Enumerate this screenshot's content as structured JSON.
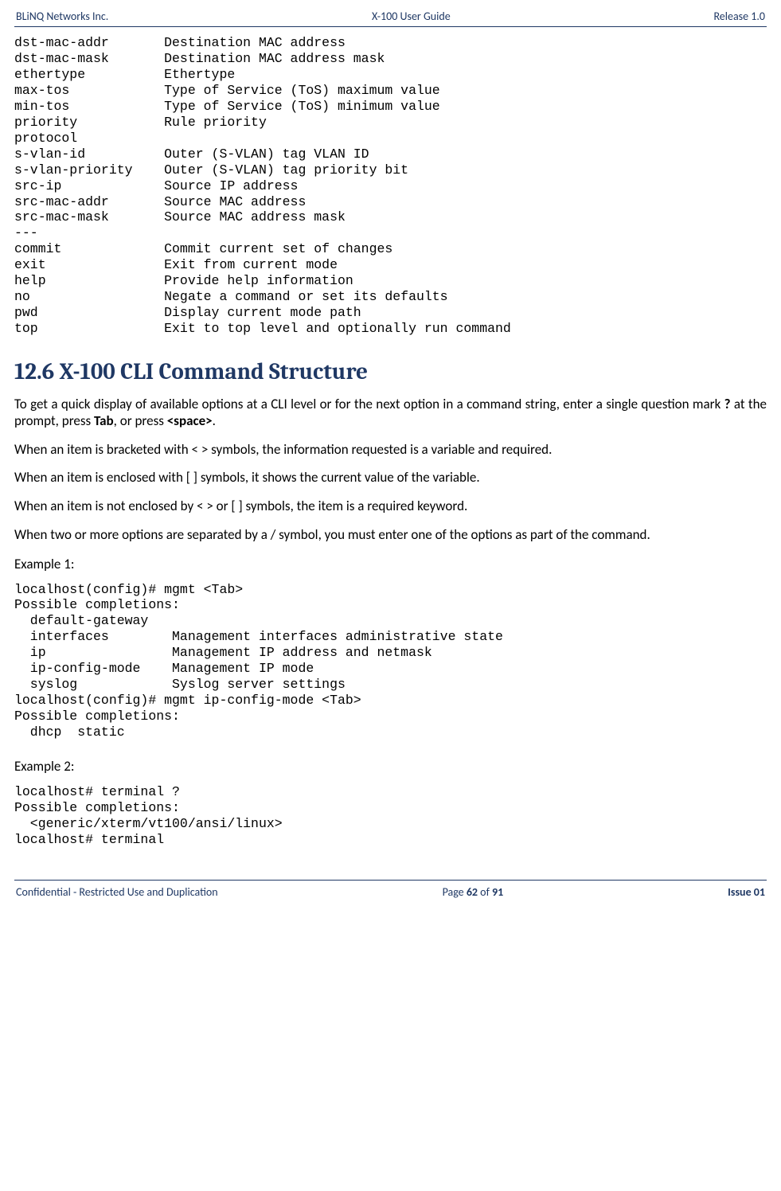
{
  "header": {
    "left": "BLiNQ Networks Inc.",
    "center": "X-100 User Guide",
    "right": "Release 1.0"
  },
  "code1_lines": [
    {
      "cmd": "dst-mac-addr",
      "desc": "Destination MAC address"
    },
    {
      "cmd": "dst-mac-mask",
      "desc": "Destination MAC address mask"
    },
    {
      "cmd": "ethertype",
      "desc": "Ethertype"
    },
    {
      "cmd": "max-tos",
      "desc": "Type of Service (ToS) maximum value"
    },
    {
      "cmd": "min-tos",
      "desc": "Type of Service (ToS) minimum value"
    },
    {
      "cmd": "priority",
      "desc": "Rule priority"
    },
    {
      "cmd": "protocol",
      "desc": ""
    },
    {
      "cmd": "s-vlan-id",
      "desc": "Outer (S-VLAN) tag VLAN ID"
    },
    {
      "cmd": "s-vlan-priority",
      "desc": "Outer (S-VLAN) tag priority bit"
    },
    {
      "cmd": "src-ip",
      "desc": "Source IP address"
    },
    {
      "cmd": "src-mac-addr",
      "desc": "Source MAC address"
    },
    {
      "cmd": "src-mac-mask",
      "desc": "Source MAC address mask"
    },
    {
      "cmd": "---",
      "desc": ""
    },
    {
      "cmd": "commit",
      "desc": "Commit current set of changes"
    },
    {
      "cmd": "exit",
      "desc": "Exit from current mode"
    },
    {
      "cmd": "help",
      "desc": "Provide help information"
    },
    {
      "cmd": "no",
      "desc": "Negate a command or set its defaults"
    },
    {
      "cmd": "pwd",
      "desc": "Display current mode path"
    },
    {
      "cmd": "top",
      "desc": "Exit to top level and optionally run command"
    }
  ],
  "section_title": "12.6 X-100 CLI Command Structure",
  "para1_pre": "To get a quick display of available options at a CLI level or for the next option in a command string, enter a single question mark ",
  "para1_q": "?",
  "para1_mid1": " at the prompt, press ",
  "para1_tab": "Tab",
  "para1_mid2": ", or press ",
  "para1_space": "<space>",
  "para1_end": ".",
  "para2": "When an item is bracketed with < > symbols, the information requested is a variable and required.",
  "para3": "When an item is enclosed with [ ] symbols, it shows the current value of the variable.",
  "para4": "When an item is not enclosed by < > or [ ] symbols, the item is a required keyword.",
  "para5": "When two or more options are separated by a / symbol, you must enter one of the options as part of the command.",
  "example1_label": "Example 1:",
  "example1_code": "localhost(config)# mgmt <Tab>\nPossible completions:\n  default-gateway\n  interfaces        Management interfaces administrative state\n  ip                Management IP address and netmask\n  ip-config-mode    Management IP mode\n  syslog            Syslog server settings\nlocalhost(config)# mgmt ip-config-mode <Tab>\nPossible completions:\n  dhcp  static",
  "example2_label": "Example 2:",
  "example2_code": "localhost# terminal ?\nPossible completions:\n  <generic/xterm/vt100/ansi/linux>\nlocalhost# terminal",
  "footer": {
    "left": "Confidential - Restricted Use and Duplication",
    "center_pre": "Page ",
    "center_page": "62",
    "center_mid": " of ",
    "center_total": "91",
    "right": "Issue 01"
  }
}
